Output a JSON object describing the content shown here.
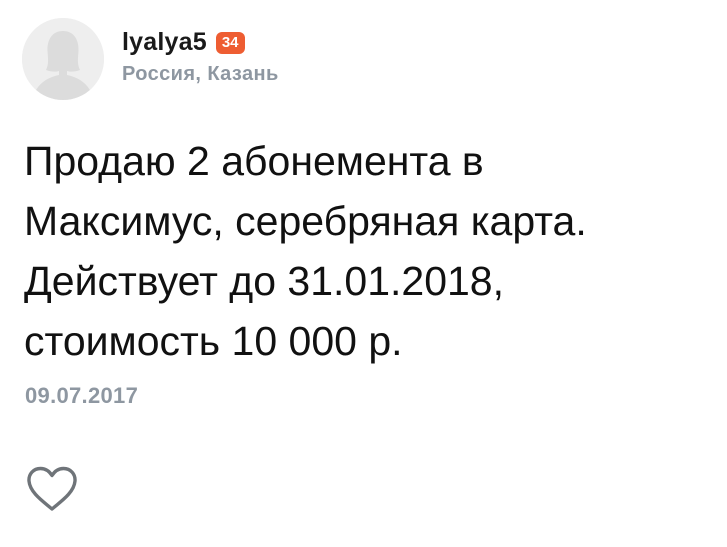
{
  "user": {
    "username": "lyalya5",
    "badge_count": "34",
    "location": "Россия, Казань",
    "avatar_icon": "user-silhouette-icon"
  },
  "post": {
    "text": "Продаю 2 абонемента в\nМаксимус, серебряная карта.\nДействует до  31.01.2018,\nстоимость 10 000 р.",
    "date": "09.07.2017"
  },
  "actions": {
    "like_icon": "heart-outline-icon"
  },
  "colors": {
    "badge": "#ee5d32",
    "muted_text": "#8e97a1",
    "avatar_bg": "#eeeeee",
    "avatar_figure": "#dcdcdc",
    "icon_stroke": "#6f7479"
  }
}
